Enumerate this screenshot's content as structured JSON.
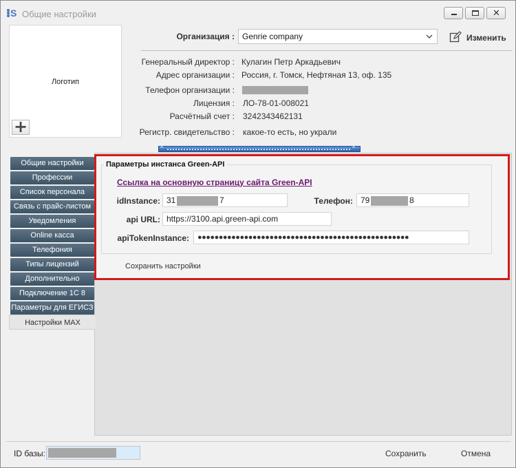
{
  "window": {
    "title": "Общие настройки",
    "controls": {
      "close": "✕"
    }
  },
  "logo": {
    "label": "Логотип",
    "add_button": "+"
  },
  "organization": {
    "label": "Организация :",
    "selected": "Genrie company",
    "edit_label": "Изменить",
    "fields": {
      "director": {
        "label": "Генеральный директор :",
        "value": "Кулагин Петр Аркадьевич"
      },
      "address": {
        "label": "Адрес организации :",
        "value": "Россия, г. Томск, Нефтяная 13, оф. 135"
      },
      "phone": {
        "label": "Телефон организации :",
        "value": ""
      },
      "license": {
        "label": "Лицензия :",
        "value": "ЛО-78-01-008021"
      },
      "account": {
        "label": "Расчётный счет :",
        "value": "3242343462131"
      },
      "certificate": {
        "label": "Регистр. свидетельство :",
        "value": "какое-то есть, но украли"
      }
    }
  },
  "collapse_bar": {
    "left_arrow": "^",
    "right_arrow": "^"
  },
  "tabs": [
    {
      "label": "Общие настройки",
      "active": false
    },
    {
      "label": "Профессии",
      "active": false
    },
    {
      "label": "Список персонала",
      "active": false
    },
    {
      "label": "Связь с прайс-листом",
      "active": false
    },
    {
      "label": "Уведомления",
      "active": false
    },
    {
      "label": "Online касса",
      "active": false
    },
    {
      "label": "Телефония",
      "active": false
    },
    {
      "label": "Типы лицензий",
      "active": false
    },
    {
      "label": "Дополнительно",
      "active": false
    },
    {
      "label": "Подключение 1С 8",
      "active": false
    },
    {
      "label": "Параметры для ЕГИСЗ",
      "active": false
    },
    {
      "label": "Настройки MAX",
      "active": true
    }
  ],
  "green_api": {
    "group_title": "Параметры инстанса Green-API",
    "link_text": "Ссылка на основную страницу сайта Green-API",
    "id_instance": {
      "label": "idInstance:",
      "prefix": "31",
      "suffix": "7"
    },
    "phone": {
      "label": "Телефон:",
      "prefix": "79",
      "suffix": "8"
    },
    "api_url": {
      "label": "api URL:",
      "value": "https://3100.api.green-api.com"
    },
    "api_token": {
      "label": "apiTokenInstance:",
      "value": "●●●●●●●●●●●●●●●●●●●●●●●●●●●●●●●●●●●●●●●●●●●●●●●●●●"
    },
    "save_label": "Сохранить настройки"
  },
  "footer": {
    "db_label": "ID базы:",
    "save_label": "Сохранить",
    "cancel_label": "Отмена"
  },
  "colors": {
    "highlight": "#d11b1b",
    "tab_bg": "#4b6173",
    "link": "#6b1a70"
  }
}
